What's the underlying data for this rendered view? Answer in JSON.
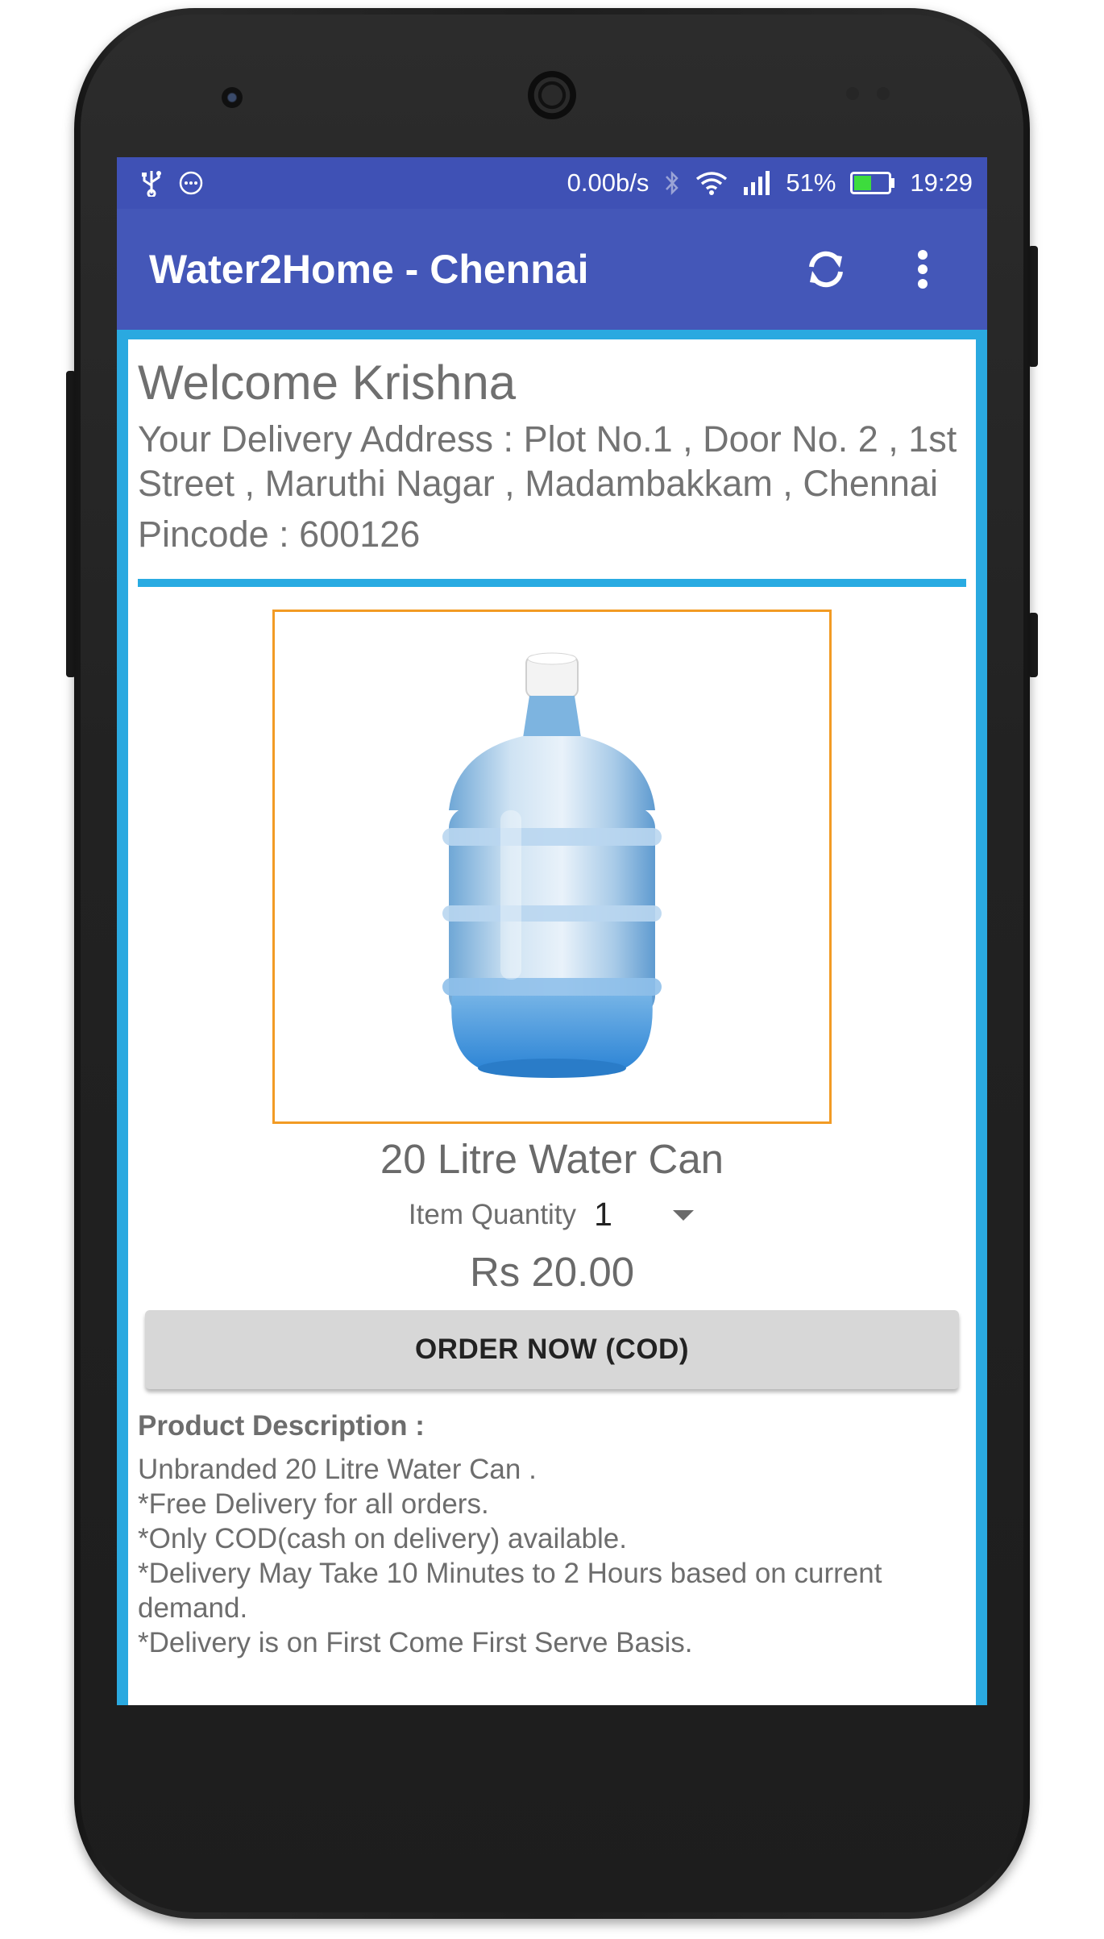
{
  "statusbar": {
    "left_icons": [
      "usb-icon",
      "chat-bubble-icon"
    ],
    "network_speed": "0.00b/s",
    "battery_percent": "51%",
    "battery_level": 0.51,
    "time": "19:29"
  },
  "appbar": {
    "title": "Water2Home - Chennai",
    "actions": [
      "refresh-icon",
      "more-vert-icon"
    ]
  },
  "user": {
    "welcome": "Welcome Krishna",
    "address_line": "Your Delivery Address : Plot No.1 , Door No. 2 , 1st Street , Maruthi Nagar , Madambakkam , Chennai",
    "pincode_line": "Pincode : 600126"
  },
  "product": {
    "name": "20 Litre Water Can",
    "quantity_label": "Item Quantity",
    "quantity_value": "1",
    "price": "Rs 20.00",
    "order_button": "ORDER NOW (COD)",
    "description_heading": "Product Description :",
    "description_lines": [
      "Unbranded 20 Litre Water Can .",
      "*Free Delivery for all orders.",
      "*Only COD(cash on delivery) available.",
      "*Delivery May Take 10 Minutes to 2 Hours based on current demand.",
      "*Delivery is on First Come First Serve Basis."
    ]
  },
  "colors": {
    "primary": "#3f51b5",
    "accent_border": "#29abe2",
    "image_frame": "#f29b24",
    "button_bg": "#d7d7d7"
  }
}
